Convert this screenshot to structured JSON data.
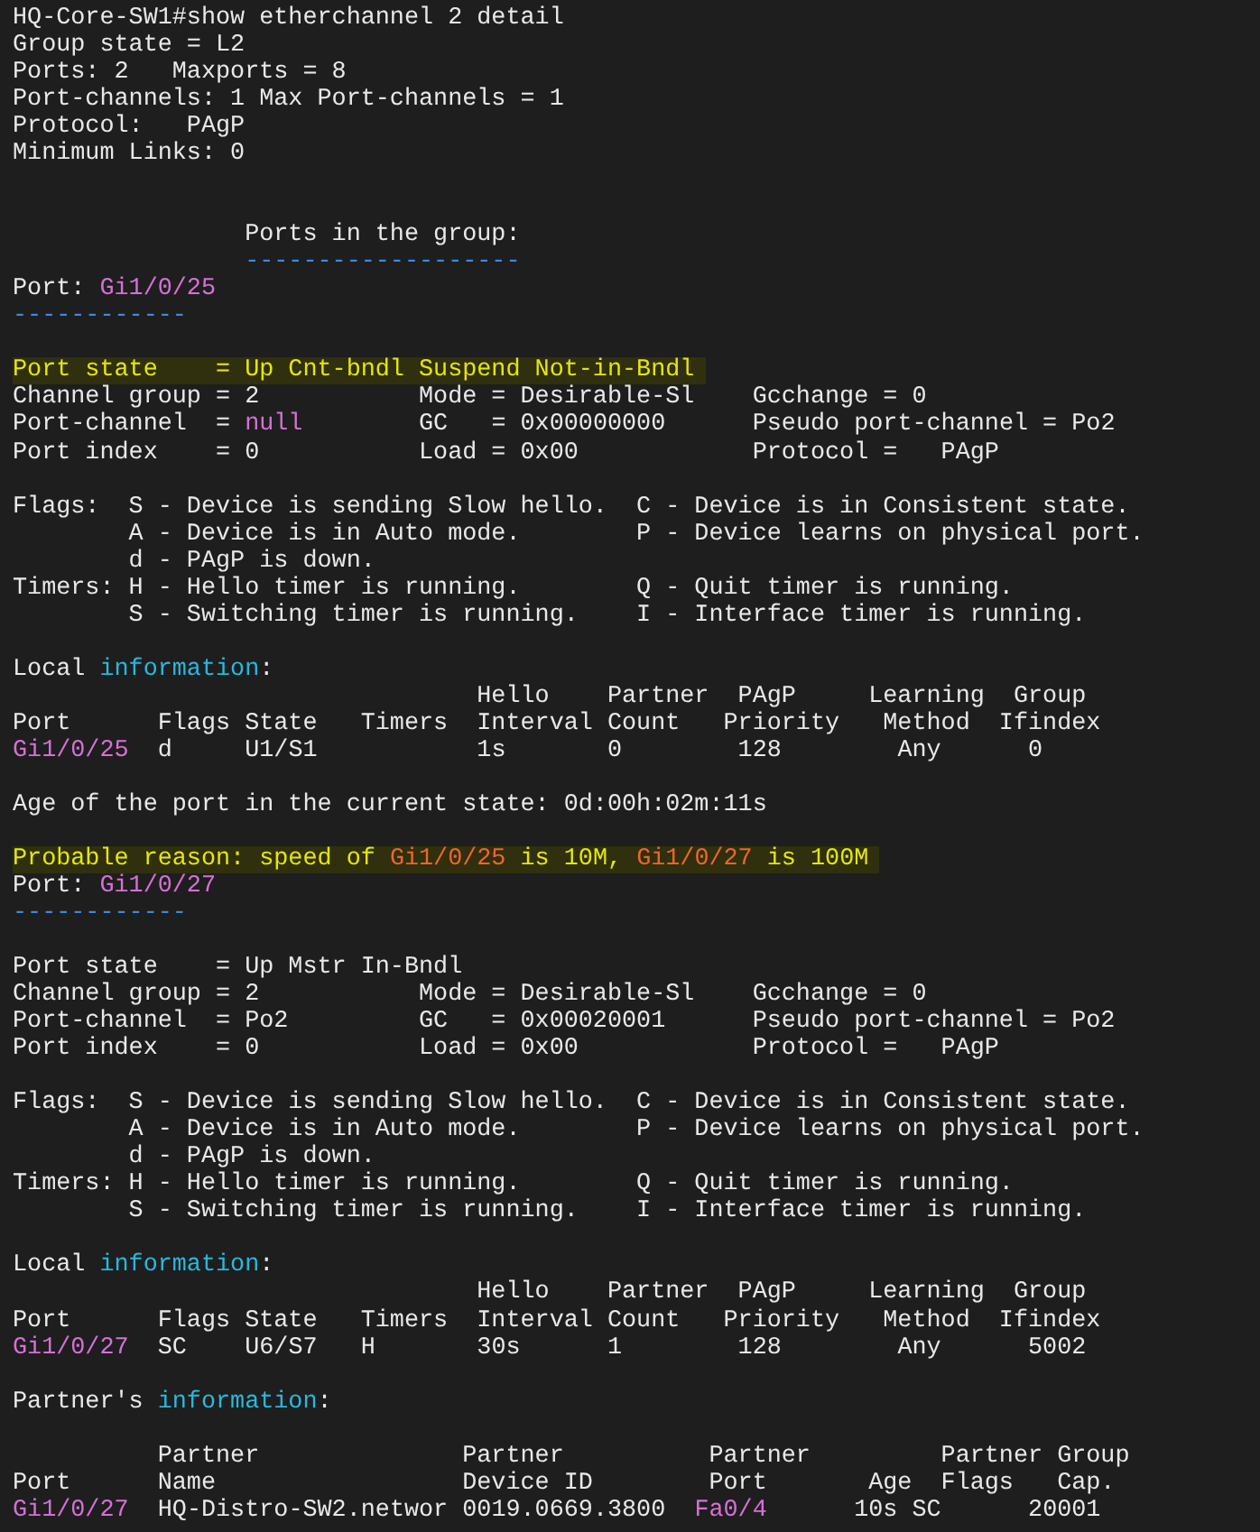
{
  "terminal": {
    "lines": [
      {
        "kind": "text",
        "highlighted": false,
        "spans": [
          {
            "text": "HQ-Core-SW1#show etherchannel 2 detail"
          }
        ]
      },
      {
        "kind": "text",
        "highlighted": false,
        "spans": [
          {
            "text": "Group state = L2"
          }
        ]
      },
      {
        "kind": "text",
        "highlighted": false,
        "spans": [
          {
            "text": "Ports: 2   Maxports = 8"
          }
        ]
      },
      {
        "kind": "text",
        "highlighted": false,
        "spans": [
          {
            "text": "Port-channels: 1 Max Port-channels = 1"
          }
        ]
      },
      {
        "kind": "text",
        "highlighted": false,
        "spans": [
          {
            "text": "Protocol:   PAgP"
          }
        ]
      },
      {
        "kind": "text",
        "highlighted": false,
        "spans": [
          {
            "text": "Minimum Links: 0"
          }
        ]
      },
      {
        "kind": "blank"
      },
      {
        "kind": "blank"
      },
      {
        "kind": "text",
        "highlighted": false,
        "spans": [
          {
            "text": "                Ports in the group:"
          }
        ]
      },
      {
        "kind": "text",
        "highlighted": false,
        "spans": [
          {
            "text": "                -------------------",
            "color": "#3b8eea"
          }
        ]
      },
      {
        "kind": "text",
        "highlighted": false,
        "spans": [
          {
            "text": "Port: "
          },
          {
            "text": "Gi1/0/25",
            "color": "#d670d6"
          }
        ]
      },
      {
        "kind": "text",
        "highlighted": false,
        "spans": [
          {
            "text": "------------",
            "color": "#3b8eea"
          }
        ]
      },
      {
        "kind": "blank"
      },
      {
        "kind": "text",
        "highlighted": true,
        "spans": [
          {
            "text": "Port state    = Up Cnt-bndl Suspend Not-in-Bndl",
            "color": "#e5e510"
          }
        ]
      },
      {
        "kind": "text",
        "highlighted": false,
        "spans": [
          {
            "text": "Channel group = 2           Mode = Desirable-Sl    Gcchange = 0"
          }
        ]
      },
      {
        "kind": "text",
        "highlighted": false,
        "spans": [
          {
            "text": "Port-channel  = "
          },
          {
            "text": "null",
            "color": "#d670d6"
          },
          {
            "text": "        GC   = 0x00000000      Pseudo port-channel = Po2"
          }
        ]
      },
      {
        "kind": "text",
        "highlighted": false,
        "spans": [
          {
            "text": "Port index    = 0           Load = 0x00            Protocol =   PAgP"
          }
        ]
      },
      {
        "kind": "blank"
      },
      {
        "kind": "text",
        "highlighted": false,
        "spans": [
          {
            "text": "Flags:  S - Device is sending Slow hello.  C - Device is in Consistent state."
          }
        ]
      },
      {
        "kind": "text",
        "highlighted": false,
        "spans": [
          {
            "text": "        A - Device is in Auto mode.        P - Device learns on physical port."
          }
        ]
      },
      {
        "kind": "text",
        "highlighted": false,
        "spans": [
          {
            "text": "        d - PAgP is down."
          }
        ]
      },
      {
        "kind": "text",
        "highlighted": false,
        "spans": [
          {
            "text": "Timers: H - Hello timer is running.        Q - Quit timer is running."
          }
        ]
      },
      {
        "kind": "text",
        "highlighted": false,
        "spans": [
          {
            "text": "        S - Switching timer is running.    I - Interface timer is running."
          }
        ]
      },
      {
        "kind": "blank"
      },
      {
        "kind": "text",
        "highlighted": false,
        "spans": [
          {
            "text": "Local "
          },
          {
            "text": "information",
            "color": "#29b8db"
          },
          {
            "text": ":"
          }
        ]
      },
      {
        "kind": "text",
        "highlighted": false,
        "spans": [
          {
            "text": "                                Hello    Partner  PAgP     Learning  Group"
          }
        ]
      },
      {
        "kind": "text",
        "highlighted": false,
        "spans": [
          {
            "text": "Port      Flags State   Timers  Interval Count   Priority   Method  Ifindex"
          }
        ]
      },
      {
        "kind": "text",
        "highlighted": false,
        "spans": [
          {
            "text": "Gi1/0/25",
            "color": "#d670d6"
          },
          {
            "text": "  d     U1/S1           1s       0        128        Any      0"
          }
        ]
      },
      {
        "kind": "blank"
      },
      {
        "kind": "text",
        "highlighted": false,
        "spans": [
          {
            "text": "Age of the port in the current state: 0d:00h:02m:11s"
          }
        ]
      },
      {
        "kind": "blank"
      },
      {
        "kind": "text",
        "highlighted": true,
        "spans": [
          {
            "text": "Probable reason: speed of ",
            "color": "#e5e510"
          },
          {
            "text": "Gi1/0/25",
            "color": "#f0642d"
          },
          {
            "text": " is 10M, ",
            "color": "#e5e510"
          },
          {
            "text": "Gi1/0/27",
            "color": "#f0642d"
          },
          {
            "text": " is 100M",
            "color": "#e5e510"
          }
        ]
      },
      {
        "kind": "text",
        "highlighted": false,
        "spans": [
          {
            "text": "Port: "
          },
          {
            "text": "Gi1/0/27",
            "color": "#d670d6"
          }
        ]
      },
      {
        "kind": "text",
        "highlighted": false,
        "spans": [
          {
            "text": "------------",
            "color": "#3b8eea"
          }
        ]
      },
      {
        "kind": "blank"
      },
      {
        "kind": "text",
        "highlighted": false,
        "spans": [
          {
            "text": "Port state    = Up Mstr In-Bndl"
          }
        ]
      },
      {
        "kind": "text",
        "highlighted": false,
        "spans": [
          {
            "text": "Channel group = 2           Mode = Desirable-Sl    Gcchange = 0"
          }
        ]
      },
      {
        "kind": "text",
        "highlighted": false,
        "spans": [
          {
            "text": "Port-channel  = Po2         GC   = 0x00020001      Pseudo port-channel = Po2"
          }
        ]
      },
      {
        "kind": "text",
        "highlighted": false,
        "spans": [
          {
            "text": "Port index    = 0           Load = 0x00            Protocol =   PAgP"
          }
        ]
      },
      {
        "kind": "blank"
      },
      {
        "kind": "text",
        "highlighted": false,
        "spans": [
          {
            "text": "Flags:  S - Device is sending Slow hello.  C - Device is in Consistent state."
          }
        ]
      },
      {
        "kind": "text",
        "highlighted": false,
        "spans": [
          {
            "text": "        A - Device is in Auto mode.        P - Device learns on physical port."
          }
        ]
      },
      {
        "kind": "text",
        "highlighted": false,
        "spans": [
          {
            "text": "        d - PAgP is down."
          }
        ]
      },
      {
        "kind": "text",
        "highlighted": false,
        "spans": [
          {
            "text": "Timers: H - Hello timer is running.        Q - Quit timer is running."
          }
        ]
      },
      {
        "kind": "text",
        "highlighted": false,
        "spans": [
          {
            "text": "        S - Switching timer is running.    I - Interface timer is running."
          }
        ]
      },
      {
        "kind": "blank"
      },
      {
        "kind": "text",
        "highlighted": false,
        "spans": [
          {
            "text": "Local "
          },
          {
            "text": "information",
            "color": "#29b8db"
          },
          {
            "text": ":"
          }
        ]
      },
      {
        "kind": "text",
        "highlighted": false,
        "spans": [
          {
            "text": "                                Hello    Partner  PAgP     Learning  Group"
          }
        ]
      },
      {
        "kind": "text",
        "highlighted": false,
        "spans": [
          {
            "text": "Port      Flags State   Timers  Interval Count   Priority   Method  Ifindex"
          }
        ]
      },
      {
        "kind": "text",
        "highlighted": false,
        "spans": [
          {
            "text": "Gi1/0/27",
            "color": "#d670d6"
          },
          {
            "text": "  SC    U6/S7   H       30s      1        128        Any      5002"
          }
        ]
      },
      {
        "kind": "blank"
      },
      {
        "kind": "text",
        "highlighted": false,
        "spans": [
          {
            "text": "Partner's "
          },
          {
            "text": "information",
            "color": "#29b8db"
          },
          {
            "text": ":"
          }
        ]
      },
      {
        "kind": "blank"
      },
      {
        "kind": "text",
        "highlighted": false,
        "spans": [
          {
            "text": "          Partner              Partner          Partner         Partner Group"
          }
        ]
      },
      {
        "kind": "text",
        "highlighted": false,
        "spans": [
          {
            "text": "Port      Name                 Device ID        Port       Age  Flags   Cap."
          }
        ]
      },
      {
        "kind": "text",
        "highlighted": false,
        "spans": [
          {
            "text": "Gi1/0/27",
            "color": "#d670d6"
          },
          {
            "text": "  HQ-Distro-SW2.networ 0019.0669.3800  "
          },
          {
            "text": "Fa0/4",
            "color": "#d670d6"
          },
          {
            "text": "      10s SC      20001"
          }
        ]
      }
    ]
  }
}
